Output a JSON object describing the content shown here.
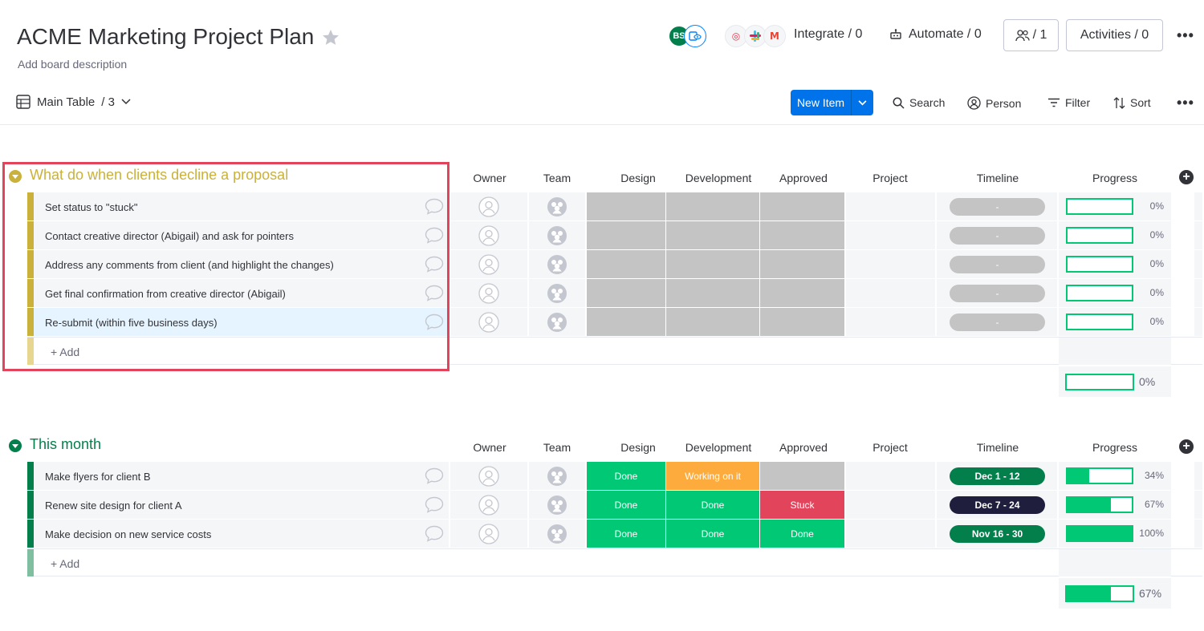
{
  "header": {
    "title": "ACME Marketing Project Plan",
    "description": "Add board description",
    "avatar_initials": "BS",
    "integrate": "Integrate / 0",
    "automate": "Automate / 0",
    "members": "/ 1",
    "activities": "Activities / 0",
    "integration_icons": [
      "twilio-icon",
      "slack-icon",
      "gmail-icon"
    ]
  },
  "toolbar": {
    "view_name": "Main Table",
    "view_count": "/ 3",
    "new_item": "New Item",
    "search": "Search",
    "person": "Person",
    "filter": "Filter",
    "sort": "Sort"
  },
  "columns": [
    "Owner",
    "Team",
    "Design",
    "Development",
    "Approved",
    "Project",
    "Timeline",
    "Progress"
  ],
  "colors": {
    "group1": "#c9b13c",
    "group2": "#037f4c",
    "done": "#00c875",
    "working": "#fdab3d",
    "stuck": "#e2445c",
    "empty": "#c4c4c4",
    "timeline_dark": "#037f4c",
    "timeline_navy": "#1f1f3d"
  },
  "groups": [
    {
      "title": "What do when clients decline a proposal",
      "add_label": "+ Add",
      "summary_progress": "0%",
      "summary_fill": 0,
      "rows": [
        {
          "name": "Set status to \"stuck\"",
          "design": "",
          "development": "",
          "approved": "",
          "timeline": "-",
          "progress": "0%",
          "fill": 0
        },
        {
          "name": "Contact creative director (Abigail) and ask for pointers",
          "design": "",
          "development": "",
          "approved": "",
          "timeline": "-",
          "progress": "0%",
          "fill": 0
        },
        {
          "name": "Address any comments from client (and highlight the changes)",
          "design": "",
          "development": "",
          "approved": "",
          "timeline": "-",
          "progress": "0%",
          "fill": 0
        },
        {
          "name": "Get final confirmation from creative director (Abigail)",
          "design": "",
          "development": "",
          "approved": "",
          "timeline": "-",
          "progress": "0%",
          "fill": 0
        },
        {
          "name": "Re-submit (within five business days)",
          "design": "",
          "development": "",
          "approved": "",
          "timeline": "-",
          "progress": "0%",
          "fill": 0
        }
      ]
    },
    {
      "title": "This month",
      "add_label": "+ Add",
      "summary_progress": "67%",
      "summary_fill": 67,
      "rows": [
        {
          "name": "Make flyers for client B",
          "design": "Done",
          "development": "Working on it",
          "approved": "",
          "timeline": "Dec 1 - 12",
          "progress": "34%",
          "fill": 34
        },
        {
          "name": "Renew site design for client A",
          "design": "Done",
          "development": "Done",
          "approved": "Stuck",
          "timeline": "Dec 7 - 24",
          "progress": "67%",
          "fill": 67
        },
        {
          "name": "Make decision on new service costs",
          "design": "Done",
          "development": "Done",
          "approved": "Done",
          "timeline": "Nov 16 - 30",
          "progress": "100%",
          "fill": 100
        }
      ]
    }
  ]
}
